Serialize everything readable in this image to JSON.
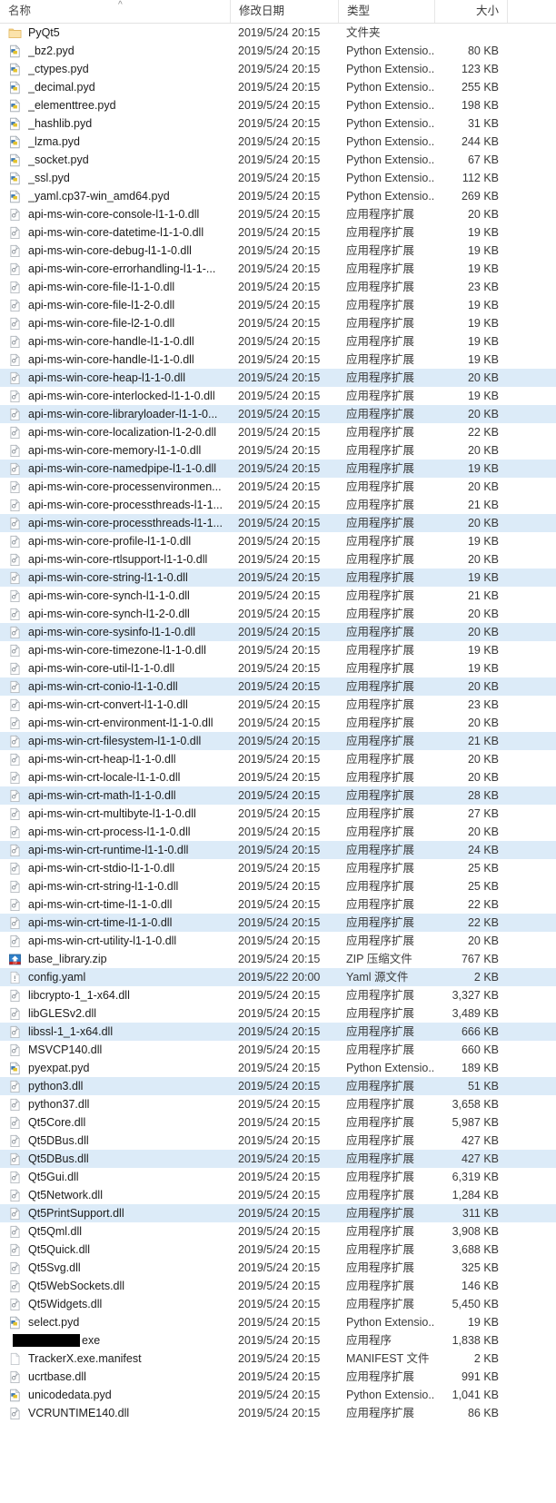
{
  "window": {
    "app": "windows-file-explorer",
    "view_mode": "details"
  },
  "colors": {
    "selection": "#dcebf8",
    "header_text": "#4a4a4a",
    "row_text": "#1b1b1b",
    "grid_line": "#e6e6e6",
    "folder_icon": "#f7d384",
    "zip_icon": "#4a90d9",
    "redaction": "#000000"
  },
  "columns": [
    {
      "key": "name",
      "label": "名称",
      "sorted": true,
      "sort_dir": "asc",
      "sort_glyph": "^"
    },
    {
      "key": "date",
      "label": "修改日期",
      "sorted": false
    },
    {
      "key": "type",
      "label": "类型",
      "sorted": false
    },
    {
      "key": "size",
      "label": "大小",
      "sorted": false
    }
  ],
  "types": {
    "folder": "文件夹",
    "python_ext": "Python Extensio...",
    "app_ext": "应用程序扩展",
    "zip": "ZIP 压缩文件",
    "yaml": "Yaml 源文件",
    "app": "应用程序",
    "manifest": "MANIFEST 文件"
  },
  "rows": [
    {
      "name": "PyQt5",
      "date": "2019/5/24 20:15",
      "type": "文件夹",
      "size": "",
      "icon": "folder-icon",
      "selected": false
    },
    {
      "name": "_bz2.pyd",
      "date": "2019/5/24 20:15",
      "type": "Python Extensio...",
      "size": "80 KB",
      "icon": "pyd-file-icon",
      "selected": false
    },
    {
      "name": "_ctypes.pyd",
      "date": "2019/5/24 20:15",
      "type": "Python Extensio...",
      "size": "123 KB",
      "icon": "pyd-file-icon",
      "selected": false
    },
    {
      "name": "_decimal.pyd",
      "date": "2019/5/24 20:15",
      "type": "Python Extensio...",
      "size": "255 KB",
      "icon": "pyd-file-icon",
      "selected": false
    },
    {
      "name": "_elementtree.pyd",
      "date": "2019/5/24 20:15",
      "type": "Python Extensio...",
      "size": "198 KB",
      "icon": "pyd-file-icon",
      "selected": false
    },
    {
      "name": "_hashlib.pyd",
      "date": "2019/5/24 20:15",
      "type": "Python Extensio...",
      "size": "31 KB",
      "icon": "pyd-file-icon",
      "selected": false
    },
    {
      "name": "_lzma.pyd",
      "date": "2019/5/24 20:15",
      "type": "Python Extensio...",
      "size": "244 KB",
      "icon": "pyd-file-icon",
      "selected": false
    },
    {
      "name": "_socket.pyd",
      "date": "2019/5/24 20:15",
      "type": "Python Extensio...",
      "size": "67 KB",
      "icon": "pyd-file-icon",
      "selected": false
    },
    {
      "name": "_ssl.pyd",
      "date": "2019/5/24 20:15",
      "type": "Python Extensio...",
      "size": "112 KB",
      "icon": "pyd-file-icon",
      "selected": false
    },
    {
      "name": "_yaml.cp37-win_amd64.pyd",
      "date": "2019/5/24 20:15",
      "type": "Python Extensio...",
      "size": "269 KB",
      "icon": "pyd-file-icon",
      "selected": false
    },
    {
      "name": "api-ms-win-core-console-l1-1-0.dll",
      "date": "2019/5/24 20:15",
      "type": "应用程序扩展",
      "size": "20 KB",
      "icon": "dll-file-icon",
      "selected": false
    },
    {
      "name": "api-ms-win-core-datetime-l1-1-0.dll",
      "date": "2019/5/24 20:15",
      "type": "应用程序扩展",
      "size": "19 KB",
      "icon": "dll-file-icon",
      "selected": false
    },
    {
      "name": "api-ms-win-core-debug-l1-1-0.dll",
      "date": "2019/5/24 20:15",
      "type": "应用程序扩展",
      "size": "19 KB",
      "icon": "dll-file-icon",
      "selected": false
    },
    {
      "name": "api-ms-win-core-errorhandling-l1-1-...",
      "date": "2019/5/24 20:15",
      "type": "应用程序扩展",
      "size": "19 KB",
      "icon": "dll-file-icon",
      "selected": false
    },
    {
      "name": "api-ms-win-core-file-l1-1-0.dll",
      "date": "2019/5/24 20:15",
      "type": "应用程序扩展",
      "size": "23 KB",
      "icon": "dll-file-icon",
      "selected": false
    },
    {
      "name": "api-ms-win-core-file-l1-2-0.dll",
      "date": "2019/5/24 20:15",
      "type": "应用程序扩展",
      "size": "19 KB",
      "icon": "dll-file-icon",
      "selected": false
    },
    {
      "name": "api-ms-win-core-file-l2-1-0.dll",
      "date": "2019/5/24 20:15",
      "type": "应用程序扩展",
      "size": "19 KB",
      "icon": "dll-file-icon",
      "selected": false
    },
    {
      "name": "api-ms-win-core-handle-l1-1-0.dll",
      "date": "2019/5/24 20:15",
      "type": "应用程序扩展",
      "size": "19 KB",
      "icon": "dll-file-icon",
      "selected": false
    },
    {
      "name": "api-ms-win-core-handle-l1-1-0.dll",
      "date": "2019/5/24 20:15",
      "type": "应用程序扩展",
      "size": "19 KB",
      "icon": "dll-file-icon",
      "selected": false
    },
    {
      "name": "api-ms-win-core-heap-l1-1-0.dll",
      "date": "2019/5/24 20:15",
      "type": "应用程序扩展",
      "size": "20 KB",
      "icon": "dll-file-icon",
      "selected": true
    },
    {
      "name": "api-ms-win-core-interlocked-l1-1-0.dll",
      "date": "2019/5/24 20:15",
      "type": "应用程序扩展",
      "size": "19 KB",
      "icon": "dll-file-icon",
      "selected": false
    },
    {
      "name": "api-ms-win-core-libraryloader-l1-1-0...",
      "date": "2019/5/24 20:15",
      "type": "应用程序扩展",
      "size": "20 KB",
      "icon": "dll-file-icon",
      "selected": true
    },
    {
      "name": "api-ms-win-core-localization-l1-2-0.dll",
      "date": "2019/5/24 20:15",
      "type": "应用程序扩展",
      "size": "22 KB",
      "icon": "dll-file-icon",
      "selected": false
    },
    {
      "name": "api-ms-win-core-memory-l1-1-0.dll",
      "date": "2019/5/24 20:15",
      "type": "应用程序扩展",
      "size": "20 KB",
      "icon": "dll-file-icon",
      "selected": false
    },
    {
      "name": "api-ms-win-core-namedpipe-l1-1-0.dll",
      "date": "2019/5/24 20:15",
      "type": "应用程序扩展",
      "size": "19 KB",
      "icon": "dll-file-icon",
      "selected": true
    },
    {
      "name": "api-ms-win-core-processenvironmen...",
      "date": "2019/5/24 20:15",
      "type": "应用程序扩展",
      "size": "20 KB",
      "icon": "dll-file-icon",
      "selected": false
    },
    {
      "name": "api-ms-win-core-processthreads-l1-1...",
      "date": "2019/5/24 20:15",
      "type": "应用程序扩展",
      "size": "21 KB",
      "icon": "dll-file-icon",
      "selected": false
    },
    {
      "name": "api-ms-win-core-processthreads-l1-1...",
      "date": "2019/5/24 20:15",
      "type": "应用程序扩展",
      "size": "20 KB",
      "icon": "dll-file-icon",
      "selected": true
    },
    {
      "name": "api-ms-win-core-profile-l1-1-0.dll",
      "date": "2019/5/24 20:15",
      "type": "应用程序扩展",
      "size": "19 KB",
      "icon": "dll-file-icon",
      "selected": false
    },
    {
      "name": "api-ms-win-core-rtlsupport-l1-1-0.dll",
      "date": "2019/5/24 20:15",
      "type": "应用程序扩展",
      "size": "20 KB",
      "icon": "dll-file-icon",
      "selected": false
    },
    {
      "name": "api-ms-win-core-string-l1-1-0.dll",
      "date": "2019/5/24 20:15",
      "type": "应用程序扩展",
      "size": "19 KB",
      "icon": "dll-file-icon",
      "selected": true
    },
    {
      "name": "api-ms-win-core-synch-l1-1-0.dll",
      "date": "2019/5/24 20:15",
      "type": "应用程序扩展",
      "size": "21 KB",
      "icon": "dll-file-icon",
      "selected": false
    },
    {
      "name": "api-ms-win-core-synch-l1-2-0.dll",
      "date": "2019/5/24 20:15",
      "type": "应用程序扩展",
      "size": "20 KB",
      "icon": "dll-file-icon",
      "selected": false
    },
    {
      "name": "api-ms-win-core-sysinfo-l1-1-0.dll",
      "date": "2019/5/24 20:15",
      "type": "应用程序扩展",
      "size": "20 KB",
      "icon": "dll-file-icon",
      "selected": true
    },
    {
      "name": "api-ms-win-core-timezone-l1-1-0.dll",
      "date": "2019/5/24 20:15",
      "type": "应用程序扩展",
      "size": "19 KB",
      "icon": "dll-file-icon",
      "selected": false
    },
    {
      "name": "api-ms-win-core-util-l1-1-0.dll",
      "date": "2019/5/24 20:15",
      "type": "应用程序扩展",
      "size": "19 KB",
      "icon": "dll-file-icon",
      "selected": false
    },
    {
      "name": "api-ms-win-crt-conio-l1-1-0.dll",
      "date": "2019/5/24 20:15",
      "type": "应用程序扩展",
      "size": "20 KB",
      "icon": "dll-file-icon",
      "selected": true
    },
    {
      "name": "api-ms-win-crt-convert-l1-1-0.dll",
      "date": "2019/5/24 20:15",
      "type": "应用程序扩展",
      "size": "23 KB",
      "icon": "dll-file-icon",
      "selected": false
    },
    {
      "name": "api-ms-win-crt-environment-l1-1-0.dll",
      "date": "2019/5/24 20:15",
      "type": "应用程序扩展",
      "size": "20 KB",
      "icon": "dll-file-icon",
      "selected": false
    },
    {
      "name": "api-ms-win-crt-filesystem-l1-1-0.dll",
      "date": "2019/5/24 20:15",
      "type": "应用程序扩展",
      "size": "21 KB",
      "icon": "dll-file-icon",
      "selected": true
    },
    {
      "name": "api-ms-win-crt-heap-l1-1-0.dll",
      "date": "2019/5/24 20:15",
      "type": "应用程序扩展",
      "size": "20 KB",
      "icon": "dll-file-icon",
      "selected": false
    },
    {
      "name": "api-ms-win-crt-locale-l1-1-0.dll",
      "date": "2019/5/24 20:15",
      "type": "应用程序扩展",
      "size": "20 KB",
      "icon": "dll-file-icon",
      "selected": false
    },
    {
      "name": "api-ms-win-crt-math-l1-1-0.dll",
      "date": "2019/5/24 20:15",
      "type": "应用程序扩展",
      "size": "28 KB",
      "icon": "dll-file-icon",
      "selected": true
    },
    {
      "name": "api-ms-win-crt-multibyte-l1-1-0.dll",
      "date": "2019/5/24 20:15",
      "type": "应用程序扩展",
      "size": "27 KB",
      "icon": "dll-file-icon",
      "selected": false
    },
    {
      "name": "api-ms-win-crt-process-l1-1-0.dll",
      "date": "2019/5/24 20:15",
      "type": "应用程序扩展",
      "size": "20 KB",
      "icon": "dll-file-icon",
      "selected": false
    },
    {
      "name": "api-ms-win-crt-runtime-l1-1-0.dll",
      "date": "2019/5/24 20:15",
      "type": "应用程序扩展",
      "size": "24 KB",
      "icon": "dll-file-icon",
      "selected": true
    },
    {
      "name": "api-ms-win-crt-stdio-l1-1-0.dll",
      "date": "2019/5/24 20:15",
      "type": "应用程序扩展",
      "size": "25 KB",
      "icon": "dll-file-icon",
      "selected": false
    },
    {
      "name": "api-ms-win-crt-string-l1-1-0.dll",
      "date": "2019/5/24 20:15",
      "type": "应用程序扩展",
      "size": "25 KB",
      "icon": "dll-file-icon",
      "selected": false
    },
    {
      "name": "api-ms-win-crt-time-l1-1-0.dll",
      "date": "2019/5/24 20:15",
      "type": "应用程序扩展",
      "size": "22 KB",
      "icon": "dll-file-icon",
      "selected": false
    },
    {
      "name": "api-ms-win-crt-time-l1-1-0.dll",
      "date": "2019/5/24 20:15",
      "type": "应用程序扩展",
      "size": "22 KB",
      "icon": "dll-file-icon",
      "selected": true
    },
    {
      "name": "api-ms-win-crt-utility-l1-1-0.dll",
      "date": "2019/5/24 20:15",
      "type": "应用程序扩展",
      "size": "20 KB",
      "icon": "dll-file-icon",
      "selected": false
    },
    {
      "name": "base_library.zip",
      "date": "2019/5/24 20:15",
      "type": "ZIP 压缩文件",
      "size": "767 KB",
      "icon": "zip-file-icon",
      "selected": false
    },
    {
      "name": "config.yaml",
      "date": "2019/5/22 20:00",
      "type": "Yaml 源文件",
      "size": "2 KB",
      "icon": "yaml-file-icon",
      "selected": true
    },
    {
      "name": "libcrypto-1_1-x64.dll",
      "date": "2019/5/24 20:15",
      "type": "应用程序扩展",
      "size": "3,327 KB",
      "icon": "dll-file-icon",
      "selected": false
    },
    {
      "name": "libGLESv2.dll",
      "date": "2019/5/24 20:15",
      "type": "应用程序扩展",
      "size": "3,489 KB",
      "icon": "dll-file-icon",
      "selected": false
    },
    {
      "name": "libssl-1_1-x64.dll",
      "date": "2019/5/24 20:15",
      "type": "应用程序扩展",
      "size": "666 KB",
      "icon": "dll-file-icon",
      "selected": true
    },
    {
      "name": "MSVCP140.dll",
      "date": "2019/5/24 20:15",
      "type": "应用程序扩展",
      "size": "660 KB",
      "icon": "dll-file-icon",
      "selected": false
    },
    {
      "name": "pyexpat.pyd",
      "date": "2019/5/24 20:15",
      "type": "Python Extensio...",
      "size": "189 KB",
      "icon": "pyd-file-icon",
      "selected": false
    },
    {
      "name": "python3.dll",
      "date": "2019/5/24 20:15",
      "type": "应用程序扩展",
      "size": "51 KB",
      "icon": "dll-file-icon",
      "selected": true
    },
    {
      "name": "python37.dll",
      "date": "2019/5/24 20:15",
      "type": "应用程序扩展",
      "size": "3,658 KB",
      "icon": "dll-file-icon",
      "selected": false
    },
    {
      "name": "Qt5Core.dll",
      "date": "2019/5/24 20:15",
      "type": "应用程序扩展",
      "size": "5,987 KB",
      "icon": "dll-file-icon",
      "selected": false
    },
    {
      "name": "Qt5DBus.dll",
      "date": "2019/5/24 20:15",
      "type": "应用程序扩展",
      "size": "427 KB",
      "icon": "dll-file-icon",
      "selected": false
    },
    {
      "name": "Qt5DBus.dll",
      "date": "2019/5/24 20:15",
      "type": "应用程序扩展",
      "size": "427 KB",
      "icon": "dll-file-icon",
      "selected": true
    },
    {
      "name": "Qt5Gui.dll",
      "date": "2019/5/24 20:15",
      "type": "应用程序扩展",
      "size": "6,319 KB",
      "icon": "dll-file-icon",
      "selected": false
    },
    {
      "name": "Qt5Network.dll",
      "date": "2019/5/24 20:15",
      "type": "应用程序扩展",
      "size": "1,284 KB",
      "icon": "dll-file-icon",
      "selected": false
    },
    {
      "name": "Qt5PrintSupport.dll",
      "date": "2019/5/24 20:15",
      "type": "应用程序扩展",
      "size": "311 KB",
      "icon": "dll-file-icon",
      "selected": true
    },
    {
      "name": "Qt5Qml.dll",
      "date": "2019/5/24 20:15",
      "type": "应用程序扩展",
      "size": "3,908 KB",
      "icon": "dll-file-icon",
      "selected": false
    },
    {
      "name": "Qt5Quick.dll",
      "date": "2019/5/24 20:15",
      "type": "应用程序扩展",
      "size": "3,688 KB",
      "icon": "dll-file-icon",
      "selected": false
    },
    {
      "name": "Qt5Svg.dll",
      "date": "2019/5/24 20:15",
      "type": "应用程序扩展",
      "size": "325 KB",
      "icon": "dll-file-icon",
      "selected": false
    },
    {
      "name": "Qt5WebSockets.dll",
      "date": "2019/5/24 20:15",
      "type": "应用程序扩展",
      "size": "146 KB",
      "icon": "dll-file-icon",
      "selected": false
    },
    {
      "name": "Qt5Widgets.dll",
      "date": "2019/5/24 20:15",
      "type": "应用程序扩展",
      "size": "5,450 KB",
      "icon": "dll-file-icon",
      "selected": false
    },
    {
      "name": "select.pyd",
      "date": "2019/5/24 20:15",
      "type": "Python Extensio...",
      "size": "19 KB",
      "icon": "pyd-file-icon",
      "selected": false
    },
    {
      "name": "exe",
      "date": "2019/5/24 20:15",
      "type": "应用程序",
      "size": "1,838 KB",
      "icon": "exe-file-icon",
      "selected": false,
      "redacted": true
    },
    {
      "name": "TrackerX.exe.manifest",
      "date": "2019/5/24 20:15",
      "type": "MANIFEST 文件",
      "size": "2 KB",
      "icon": "manifest-file-icon",
      "selected": false
    },
    {
      "name": "ucrtbase.dll",
      "date": "2019/5/24 20:15",
      "type": "应用程序扩展",
      "size": "991 KB",
      "icon": "dll-file-icon",
      "selected": false
    },
    {
      "name": "unicodedata.pyd",
      "date": "2019/5/24 20:15",
      "type": "Python Extensio...",
      "size": "1,041 KB",
      "icon": "pyd-file-icon",
      "selected": false
    },
    {
      "name": "VCRUNTIME140.dll",
      "date": "2019/5/24 20:15",
      "type": "应用程序扩展",
      "size": "86 KB",
      "icon": "dll-file-icon",
      "selected": false
    }
  ]
}
